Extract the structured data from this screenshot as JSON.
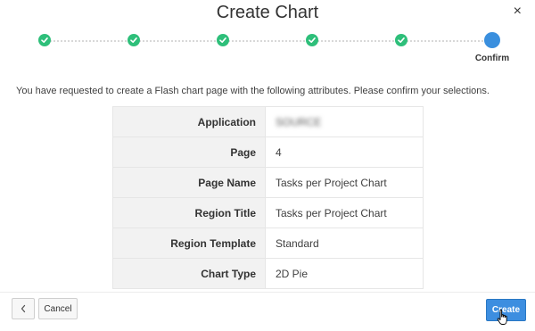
{
  "dialog": {
    "title": "Create Chart",
    "close_glyph": "×"
  },
  "wizard": {
    "steps": [
      {
        "status": "complete",
        "icon": "check-icon"
      },
      {
        "status": "complete",
        "icon": "check-icon"
      },
      {
        "status": "complete",
        "icon": "check-icon"
      },
      {
        "status": "complete",
        "icon": "check-icon"
      },
      {
        "status": "complete",
        "icon": "check-icon"
      },
      {
        "status": "current",
        "label": "Confirm"
      }
    ],
    "complete_color": "#2ebf7a",
    "current_color": "#3a8fde"
  },
  "intro_text": "You have requested to create a Flash chart page with the following attributes. Please confirm your selections.",
  "summary": [
    {
      "label": "Application",
      "value": "SOURCE",
      "redacted": true
    },
    {
      "label": "Page",
      "value": "4"
    },
    {
      "label": "Page Name",
      "value": "Tasks per Project Chart"
    },
    {
      "label": "Region Title",
      "value": "Tasks per Project Chart"
    },
    {
      "label": "Region Template",
      "value": "Standard"
    },
    {
      "label": "Chart Type",
      "value": "2D Pie"
    }
  ],
  "buttons": {
    "previous_glyph": "‹",
    "cancel": "Cancel",
    "create": "Create"
  },
  "colors": {
    "primary_button": "#3d8ee0"
  }
}
